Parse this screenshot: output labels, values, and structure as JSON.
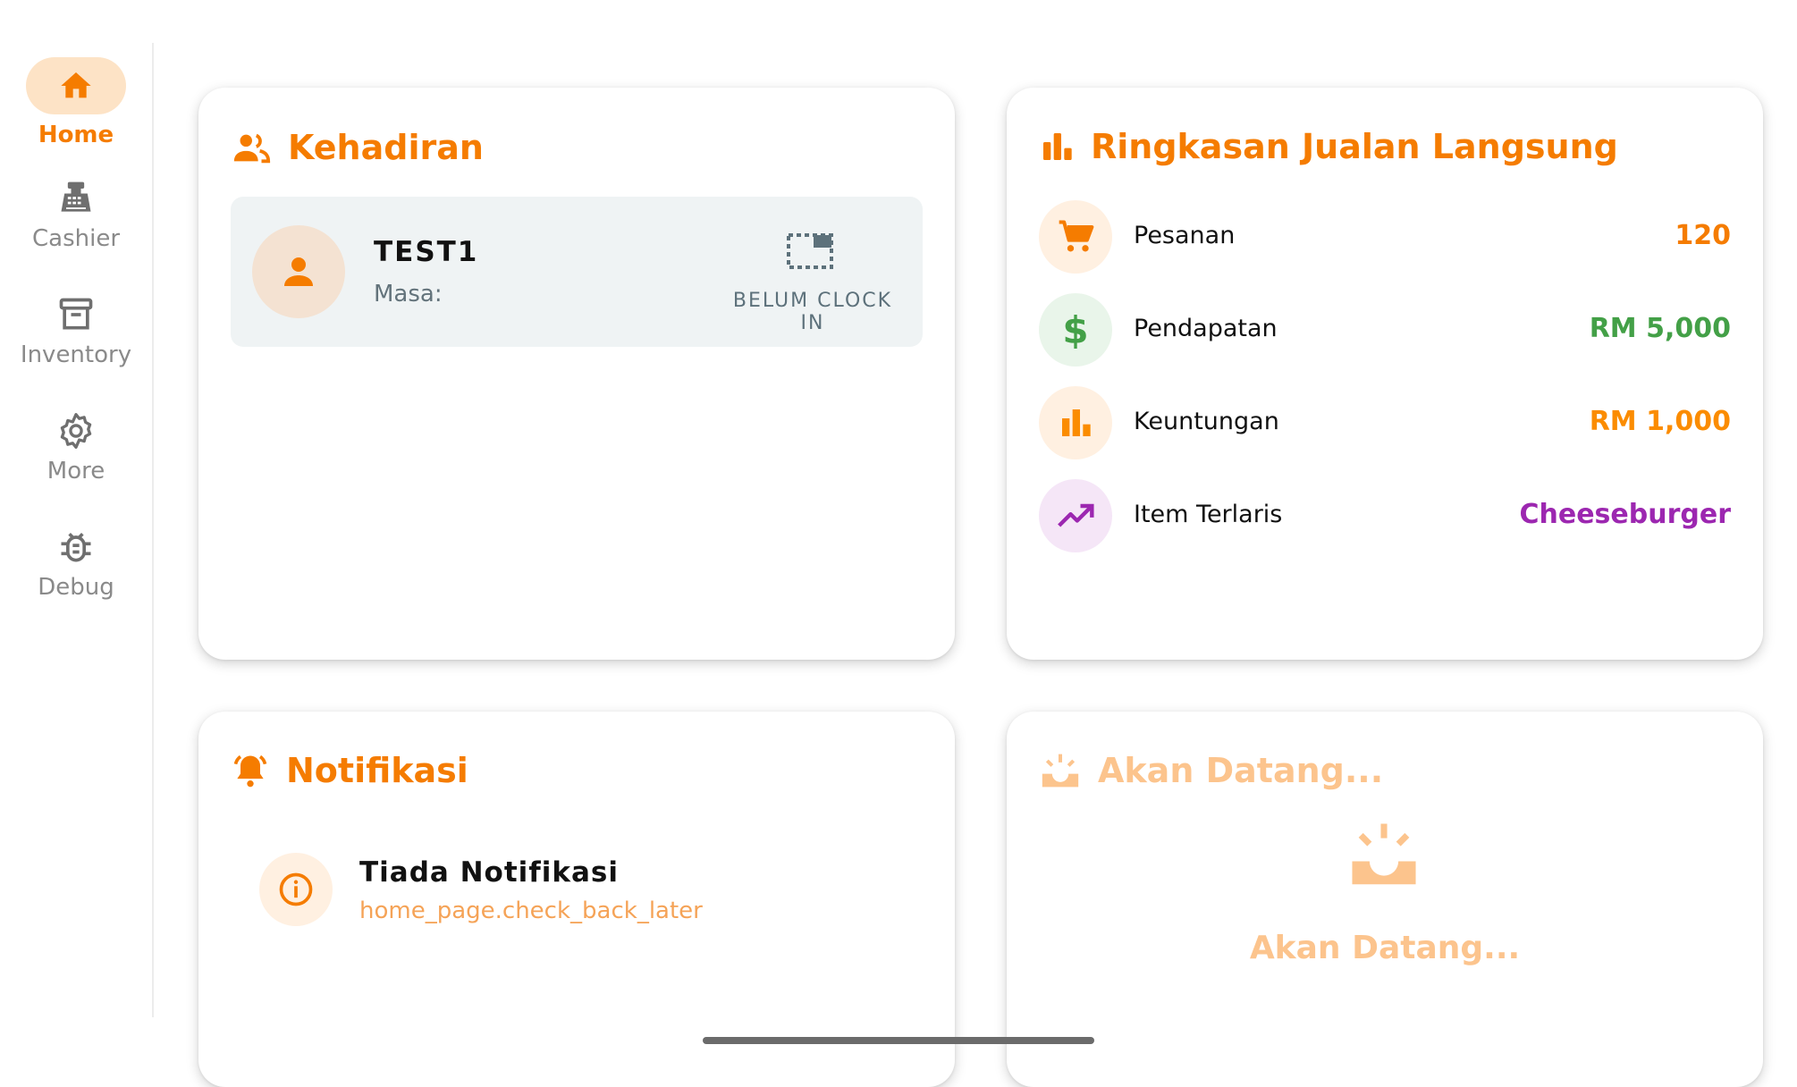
{
  "sidebar": {
    "items": [
      {
        "label": "Home",
        "icon": "home-icon"
      },
      {
        "label": "Cashier",
        "icon": "cash-register-icon"
      },
      {
        "label": "Inventory",
        "icon": "archive-icon"
      },
      {
        "label": "More",
        "icon": "gear-icon"
      },
      {
        "label": "Debug",
        "icon": "bug-icon"
      }
    ]
  },
  "attendance": {
    "title": "Kehadiran",
    "employee": {
      "name": "TEST1",
      "time_label": "Masa:"
    },
    "status": "BELUM CLOCK IN"
  },
  "sales_summary": {
    "title": "Ringkasan Jualan Langsung",
    "rows": [
      {
        "label": "Pesanan",
        "value": "120",
        "icon": "cart-icon",
        "color": "#f57c00",
        "bg": "#fff0e1"
      },
      {
        "label": "Pendapatan",
        "value": "RM 5,000",
        "icon": "dollar-icon",
        "color": "#43a047",
        "bg": "#e9f5ea"
      },
      {
        "label": "Keuntungan",
        "value": "RM 1,000",
        "icon": "bar-chart-icon",
        "color": "#fb8c00",
        "bg": "#fff0e1"
      },
      {
        "label": "Item Terlaris",
        "value": "Cheeseburger",
        "icon": "trending-up-icon",
        "color": "#9c27b0",
        "bg": "#f5e6f7"
      }
    ]
  },
  "notifications": {
    "title": "Notifikasi",
    "empty_title": "Tiada Notifikasi",
    "empty_subtitle": "home_page.check_back_later"
  },
  "coming_soon": {
    "title": "Akan Datang...",
    "text": "Akan Datang..."
  },
  "colors": {
    "accent": "#f57c00",
    "accent_light": "#fcc48d",
    "nav_active_bg": "#fde3c6"
  }
}
